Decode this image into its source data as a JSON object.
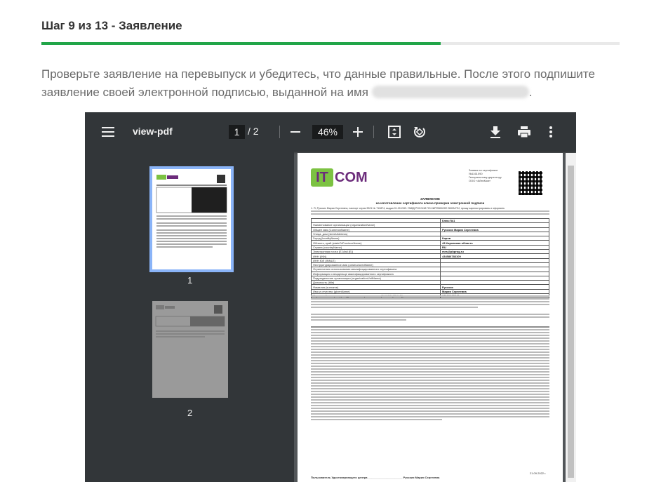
{
  "header": {
    "step_title": "Шаг 9 из 13 - Заявление",
    "progress_percent": 69
  },
  "instructions": {
    "text": "Проверьте заявление на перевыпуск и убедитесь, что данные правильные. После этого подпишите заявление своей электронной подписью, выданной на имя",
    "end": "."
  },
  "viewer": {
    "doc_name": "view-pdf",
    "current_page": "1",
    "page_total": "/  2",
    "zoom": "46%",
    "thumbnails": [
      {
        "label": "1"
      },
      {
        "label": "2"
      }
    ],
    "icons": [
      "menu-icon",
      "zoom-out-icon",
      "zoom-in-icon",
      "fit-page-icon",
      "rotate-icon",
      "download-icon",
      "print-icon",
      "more-icon"
    ]
  },
  "pdf": {
    "logo_it": "IT",
    "logo_com": "COM",
    "header_lines": [
      "Заявка на сертификат",
      "№1161090",
      "Генеральному директору",
      "ООО «АйтиКом»"
    ],
    "title": "ЗАЯВЛЕНИЕ",
    "subtitle": "на изготовление сертификата ключа проверки электронной подписи",
    "intro": "1. Я, Русских Мария Сергеевна, паспорт серия 3321 № 712874, выдан 01.09.2021 УМВД РОССИИ ПО КИРОВСКОЙ ОБЛАСТИ, прошу зарегистрировать и оформить",
    "table": [
      {
        "label": "",
        "value": "Ключ №1"
      },
      {
        "label": "Наименование организации (organizationName)",
        "value": ""
      },
      {
        "label": "Общее имя (CommonName)",
        "value": "Русских Мария Сергеевна"
      },
      {
        "label": "Улица, дом (streetAddress)",
        "value": ""
      },
      {
        "label": "Город (localityName)",
        "value": "Киров"
      },
      {
        "label": "Область, край (stateOrProvinceName)",
        "value": "43 Кировская область"
      },
      {
        "label": "Страна (countryName)",
        "value": "RU"
      },
      {
        "label": "Электронная почта (E-Mail (E))",
        "value": "mes@pbprog.ru"
      },
      {
        "label": "ИНН (INN)",
        "value": "434586783109"
      },
      {
        "label": "ИНН ЮЛ (INNLE)",
        "value": ""
      },
      {
        "label": "Неструктурированное имя (unstructuredName)",
        "value": ""
      },
      {
        "label": "Ограничения использования квалифицированного сертификата",
        "value": ""
      },
      {
        "label": "Информация о владельце квалифицированного сертификата",
        "value": ""
      },
      {
        "label": "Подразделение организации (organizationUnitName)",
        "value": ""
      },
      {
        "label": "Должность (title)",
        "value": ""
      },
      {
        "label": "Фамилия (surname)",
        "value": "Русских"
      },
      {
        "label": "Имя и отчество (givenName)",
        "value": "Мария Сергеевна"
      },
      {
        "label": "Страховой номер индивидуального лицевого счета (СНИЛС (SNILS))",
        "value": "17132166942"
      }
    ],
    "signature": "Пользователь Удостоверяющего центра ______________________ Русских Мария Сергеевна",
    "date": "21.09.2022 г."
  }
}
